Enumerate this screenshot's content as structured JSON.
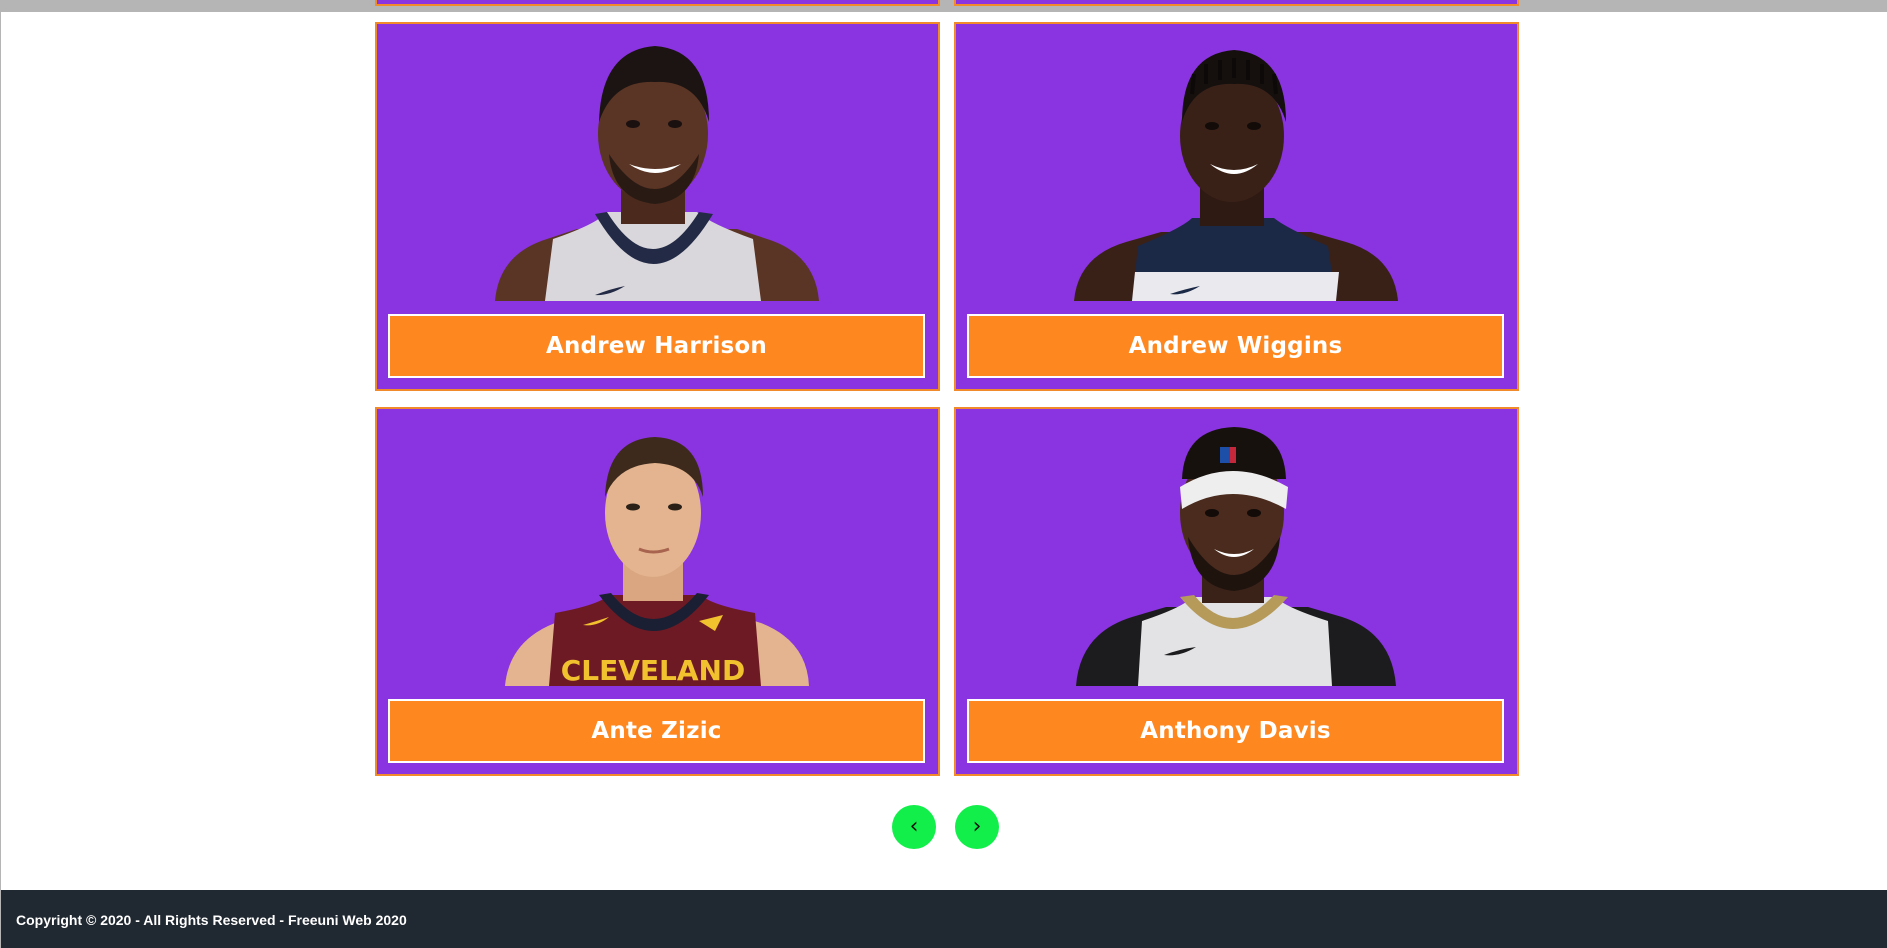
{
  "players": [
    {
      "name": "Andrew Harrison",
      "jersey": "white-navy"
    },
    {
      "name": "Andrew Wiggins",
      "jersey": "navy"
    },
    {
      "name": "Ante Zizic",
      "jersey": "wine",
      "jersey_text": "CLEVELAND"
    },
    {
      "name": "Anthony Davis",
      "jersey": "white-gold"
    }
  ],
  "pagination": {
    "prev_label": "‹",
    "next_label": "›"
  },
  "footer": {
    "copyright": "Copyright © 2020 - All Rights Reserved - Freeuni Web 2020"
  },
  "colors": {
    "card_bg": "#8a33e0",
    "card_border": "#f08a2a",
    "name_bg": "#ff871f",
    "pager_bg": "#12ee4a",
    "footer_bg": "#202831"
  },
  "icons": {
    "prev": "chevron-left-icon",
    "next": "chevron-right-icon"
  }
}
